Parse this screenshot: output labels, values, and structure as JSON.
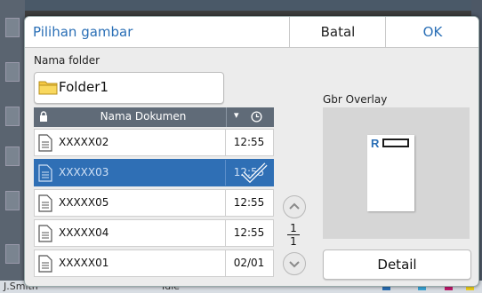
{
  "dialog": {
    "title": "Pilihan gambar",
    "cancel_label": "Batal",
    "ok_label": "OK"
  },
  "folder": {
    "label": "Nama folder",
    "value": "Folder1"
  },
  "table": {
    "header_name": "Nama Dokumen",
    "header_sort": "▾",
    "rows": [
      {
        "name": "XXXXX02",
        "time": "12:55",
        "selected": false
      },
      {
        "name": "XXXXX03",
        "time": "12:55",
        "selected": true
      },
      {
        "name": "XXXXX05",
        "time": "12:55",
        "selected": false
      },
      {
        "name": "XXXXX04",
        "time": "12:55",
        "selected": false
      },
      {
        "name": "XXXXX01",
        "time": "02/01",
        "selected": false
      }
    ]
  },
  "paging": {
    "current": "1",
    "total": "1"
  },
  "overlay": {
    "label": "Gbr Overlay",
    "preview_letter": "R",
    "detail_label": "Detail"
  },
  "background": {
    "user": "J.Smith",
    "status": "Idle"
  },
  "colors": {
    "accent": "#2a6fb6",
    "selected_row": "#2f6fb5",
    "header": "#606b78"
  }
}
